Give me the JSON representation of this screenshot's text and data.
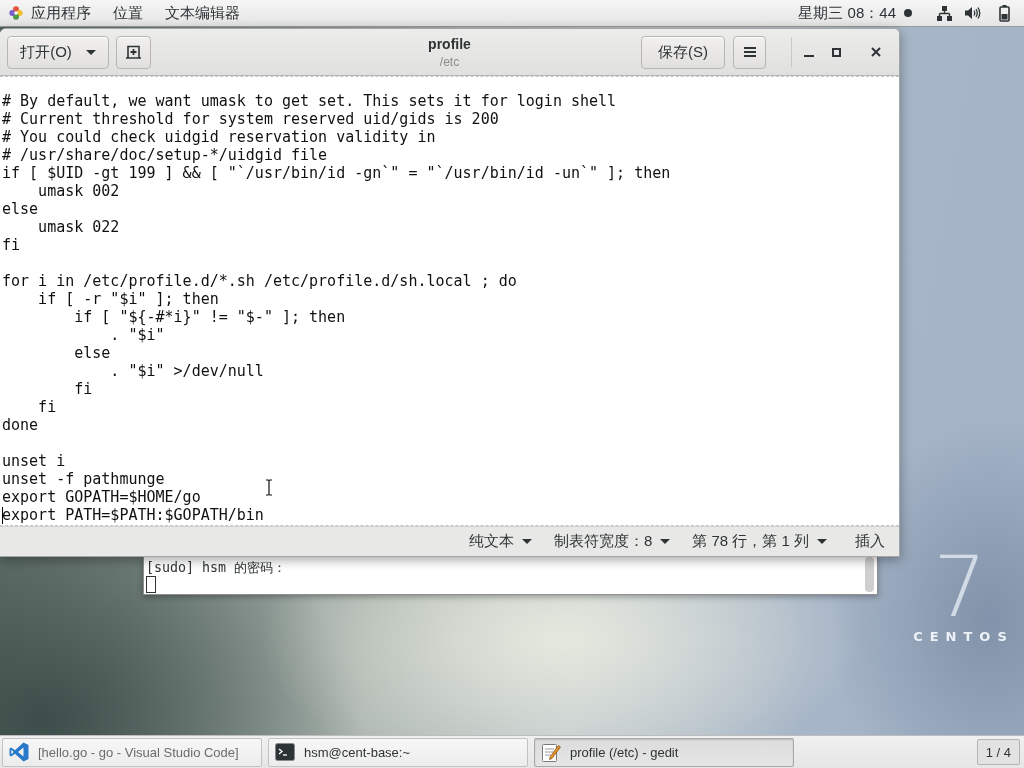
{
  "top_bar": {
    "menus": [
      "应用程序",
      "位置",
      "文本编辑器"
    ],
    "clock": "星期三 08：44"
  },
  "editor_window": {
    "open_button": "打开(O)",
    "title": "profile",
    "subtitle": "/etc",
    "save_button": "保存(S)",
    "blocks": [
      {
        "lines": [
          {
            "text": "# By default, we want umask to get set. This sets it for login shell",
            "caret": false
          },
          {
            "text": "# Current threshold for system reserved uid/gids is 200",
            "caret": false
          },
          {
            "text": "# You could check uidgid reservation validity in",
            "caret": false
          },
          {
            "text": "# /usr/share/doc/setup-*/uidgid file",
            "caret": false
          },
          {
            "text": "if [ $UID -gt 199 ] && [ \"`/usr/bin/id -gn`\" = \"`/usr/bin/id -un`\" ]; then",
            "caret": false
          },
          {
            "text": "    umask 002",
            "caret": false
          },
          {
            "text": "else",
            "caret": false
          },
          {
            "text": "    umask 022",
            "caret": false
          },
          {
            "text": "fi",
            "caret": false
          }
        ]
      },
      {
        "lines": [
          {
            "text": "for i in /etc/profile.d/*.sh /etc/profile.d/sh.local ; do",
            "caret": false
          },
          {
            "text": "    if [ -r \"$i\" ]; then",
            "caret": false
          },
          {
            "text": "        if [ \"${-#*i}\" != \"$-\" ]; then",
            "caret": false
          },
          {
            "text": "            . \"$i\"",
            "caret": false
          },
          {
            "text": "        else",
            "caret": false
          },
          {
            "text": "            . \"$i\" >/dev/null",
            "caret": false
          },
          {
            "text": "        fi",
            "caret": false
          },
          {
            "text": "    fi",
            "caret": false
          },
          {
            "text": "done",
            "caret": false
          }
        ]
      },
      {
        "lines": [
          {
            "text": "unset i",
            "caret": false
          },
          {
            "text": "unset -f pathmunge",
            "caret": false
          },
          {
            "text": "export GOPATH=$HOME/go",
            "caret": false
          },
          {
            "text": "export PATH=$PATH:$GOPATH/bin",
            "caret": true
          }
        ]
      }
    ],
    "status_items": [
      {
        "kind": "dropdown",
        "label": "纯文本"
      },
      {
        "kind": "dropdown",
        "label": "制表符宽度：8"
      },
      {
        "kind": "dropdown",
        "label": "第 78 行，第 1 列"
      },
      {
        "kind": "label",
        "label": "插入"
      }
    ]
  },
  "terminal_window": {
    "lines": [
      "[sudo] hsm 的密码："
    ]
  },
  "desktop_logo": {
    "numeral": "7",
    "name": "CENTOS"
  },
  "taskbar": {
    "items": [
      {
        "kind": "vscode",
        "title": "[hello.go - go - Visual Studio Code]",
        "minimized": true,
        "selected": false
      },
      {
        "kind": "terminal",
        "title": "hsm@cent-base:~",
        "minimized": false,
        "selected": false
      },
      {
        "kind": "editor",
        "title": "profile (/etc) - gedit",
        "minimized": false,
        "selected": true
      }
    ],
    "workspace": "1 / 4"
  }
}
